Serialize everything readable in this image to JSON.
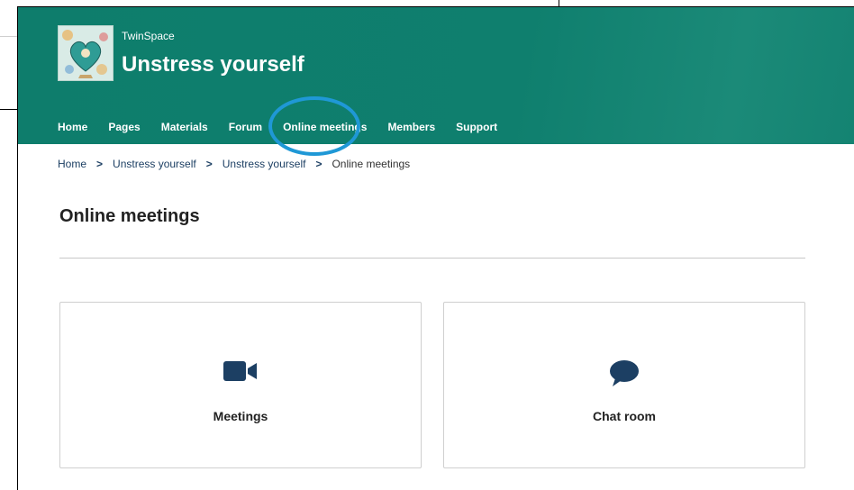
{
  "header": {
    "brand": "TwinSpace",
    "site_title": "Unstress yourself",
    "nav": [
      {
        "label": "Home"
      },
      {
        "label": "Pages"
      },
      {
        "label": "Materials"
      },
      {
        "label": "Forum"
      },
      {
        "label": "Online meetings",
        "active": true
      },
      {
        "label": "Members"
      },
      {
        "label": "Support"
      }
    ]
  },
  "breadcrumb": [
    "Home",
    "Unstress yourself",
    "Unstress yourself",
    "Online meetings"
  ],
  "breadcrumb_separator": ">",
  "page_title": "Online meetings",
  "cards": [
    {
      "label": "Meetings",
      "icon": "video-camera-icon"
    },
    {
      "label": "Chat room",
      "icon": "speech-bubble-icon"
    }
  ],
  "colors": {
    "header_green": "#0e7d6c",
    "icon_dark": "#1c3f63",
    "highlight": "#1f98d6"
  }
}
